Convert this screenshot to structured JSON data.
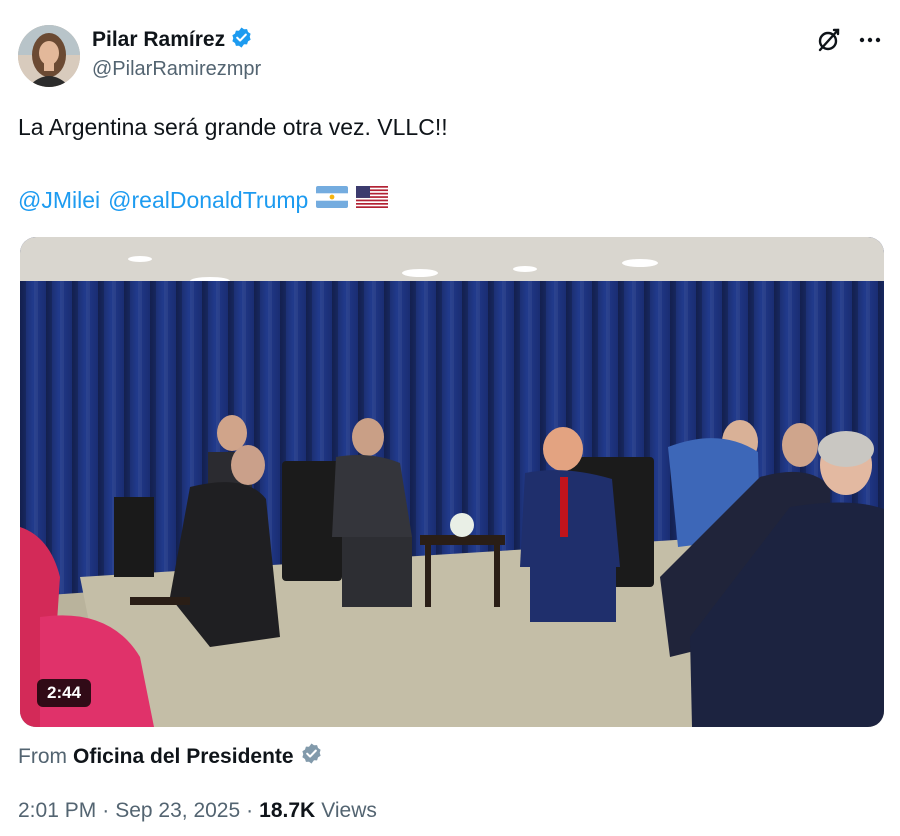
{
  "author": {
    "display_name": "Pilar Ramírez",
    "handle": "@PilarRamirezmpr",
    "verified_color": "#1d9bf0"
  },
  "tweet": {
    "text": "La Argentina será grande otra vez. VLLC!!",
    "mentions": [
      "@JMilei",
      "@realDonaldTrump"
    ],
    "flags": [
      "argentina-flag-icon",
      "us-flag-icon"
    ]
  },
  "media": {
    "duration": "2:44"
  },
  "source": {
    "prefix": "From",
    "name": "Oficina del Presidente",
    "badge_color": "#829aab"
  },
  "meta": {
    "time": "2:01 PM",
    "separator": "·",
    "date": "Sep 23, 2025",
    "views_count": "18.7K",
    "views_label": "Views"
  },
  "colors": {
    "link": "#1d9bf0",
    "secondary_text": "#536471",
    "primary_text": "#0f1419"
  }
}
